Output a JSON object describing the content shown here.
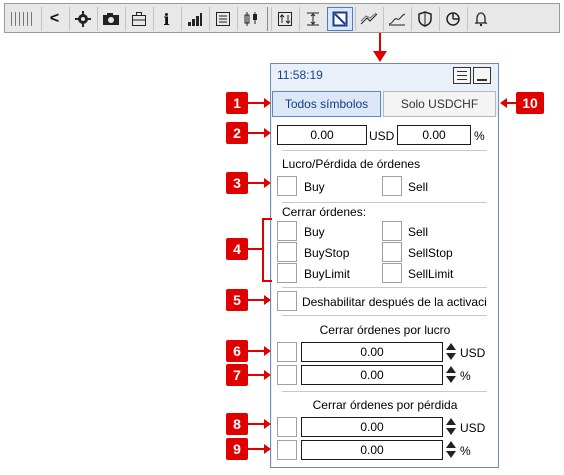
{
  "toolbar": {
    "icons": [
      "grip-icon",
      "back-icon",
      "gear-icon",
      "camera-icon",
      "briefcase-icon",
      "info-icon",
      "signal-bars-icon",
      "list-icon",
      "candles-icon",
      "swap-icon",
      "measure-icon",
      "panel-icon",
      "trend-icon",
      "line-chart-icon",
      "shield-icon",
      "pie-icon",
      "bell-icon"
    ],
    "info_glyph": "i",
    "back_glyph": "<",
    "active_tool": "panel-icon"
  },
  "panel": {
    "time": "11:58:19",
    "tabs": [
      {
        "label": "Todos símbolos",
        "active": true
      },
      {
        "label": "Solo USDCHF",
        "active": false
      }
    ],
    "amount": {
      "value_usd": "0.00",
      "unit_usd": "USD",
      "value_pct": "0.00",
      "unit_pct": "%"
    },
    "pl_section": {
      "title": "Lucro/Pérdida de órdenes",
      "buy": "Buy",
      "sell": "Sell"
    },
    "close_section": {
      "title": "Cerrar órdenes:",
      "items": [
        "Buy",
        "Sell",
        "BuyStop",
        "SellStop",
        "BuyLimit",
        "SellLimit"
      ]
    },
    "disable_label": "Deshabilitar después de la activaci",
    "profit_section": {
      "title": "Cerrar órdenes por lucro",
      "usd_value": "0.00",
      "usd_unit": "USD",
      "pct_value": "0.00",
      "pct_unit": "%"
    },
    "loss_section": {
      "title": "Cerrar órdenes por pérdida",
      "usd_value": "0.00",
      "usd_unit": "USD",
      "pct_value": "0.00",
      "pct_unit": "%"
    }
  },
  "callouts": [
    "1",
    "2",
    "3",
    "4",
    "5",
    "6",
    "7",
    "8",
    "9",
    "10"
  ],
  "colors": {
    "callout": "#e00000",
    "panel_bg": "#e9f0fa",
    "active_tab_text": "#103a86"
  }
}
